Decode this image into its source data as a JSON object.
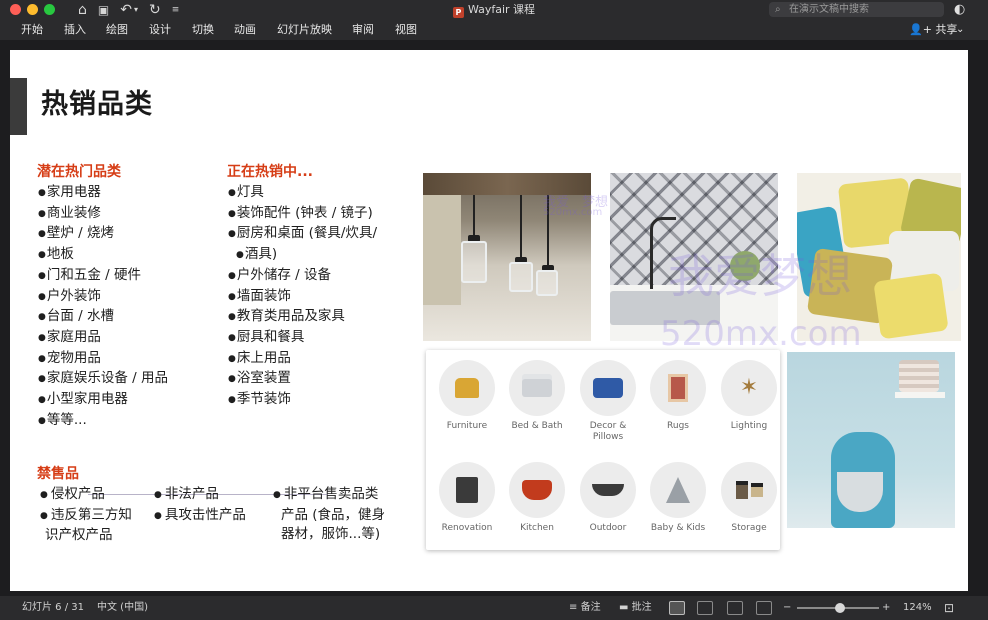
{
  "window": {
    "title": "Wayfair 课程",
    "search_placeholder": "在演示文稿中搜索"
  },
  "menu": {
    "items": [
      "开始",
      "插入",
      "绘图",
      "设计",
      "切换",
      "动画",
      "幻灯片放映",
      "审阅",
      "视图"
    ],
    "share": "共享"
  },
  "slide": {
    "title": "热销品类",
    "potential": {
      "heading": "潜在热门品类",
      "items": [
        "家用电器",
        "商业装修",
        "壁炉 / 烧烤",
        "地板",
        "门和五金 / 硬件",
        "户外装饰",
        "台面 / 水槽",
        "家庭用品",
        "宠物用品",
        "家庭娱乐设备 / 用品",
        "小型家用电器",
        "等等..."
      ]
    },
    "hot": {
      "heading": "正在热销中...",
      "items": [
        "灯具",
        "装饰配件 (钟表 / 镜子)",
        "厨房和桌面 (餐具/炊具/",
        "酒具)",
        "户外储存 / 设备",
        "墙面装饰",
        "教育类用品及家具",
        "厨具和餐具",
        "床上用品",
        "浴室装置",
        "季节装饰"
      ]
    },
    "banned": {
      "heading": "禁售品",
      "col1": [
        "侵权产品",
        "违反第三方知",
        "识产权产品"
      ],
      "col2": [
        "非法产品",
        "具攻击性产品"
      ],
      "col3": [
        "非平台售卖品类",
        "产品 (食品，健身",
        "器材，服饰...等)"
      ]
    },
    "categories": [
      {
        "label": "Furniture",
        "icon": "armchair-icon"
      },
      {
        "label": "Bed & Bath",
        "icon": "towels-icon"
      },
      {
        "label": "Decor &",
        "label2": "Pillows",
        "icon": "pillow-icon"
      },
      {
        "label": "Rugs",
        "icon": "rug-icon"
      },
      {
        "label": "Lighting",
        "icon": "chandelier-icon"
      },
      {
        "label": "Renovation",
        "icon": "appliance-icon"
      },
      {
        "label": "Kitchen",
        "icon": "dutch-oven-icon"
      },
      {
        "label": "Outdoor",
        "icon": "fire-pit-icon"
      },
      {
        "label": "Baby & Kids",
        "icon": "teepee-icon"
      },
      {
        "label": "Storage",
        "icon": "jars-icon"
      }
    ],
    "watermarks": [
      "我爱",
      "梦想",
      "520mx.com",
      "我爱梦想",
      "520mx.com"
    ]
  },
  "status": {
    "slide_counter": "幻灯片 6 / 31",
    "language": "中文 (中国)",
    "notes": "备注",
    "comments": "批注",
    "zoom": "124%"
  }
}
